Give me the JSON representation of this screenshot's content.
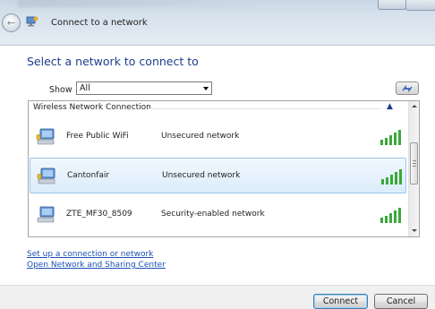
{
  "window": {
    "title": "Connect to a network"
  },
  "heading": "Select a network to connect to",
  "filter": {
    "label": "Show",
    "selected": "All"
  },
  "network_list": {
    "group_label": "Wireless Network Connection",
    "networks": [
      {
        "ssid": "Free Public WiFi",
        "security": "Unsecured network",
        "selected": false,
        "signal_bars": 5,
        "shield": true
      },
      {
        "ssid": "Cantonfair",
        "security": "Unsecured network",
        "selected": true,
        "signal_bars": 5,
        "shield": true
      },
      {
        "ssid": "ZTE_MF30_8509",
        "security": "Security-enabled network",
        "selected": false,
        "signal_bars": 5,
        "shield": false
      }
    ]
  },
  "links": {
    "setup": "Set up a connection or network",
    "sharing_center": "Open Network and Sharing Center"
  },
  "buttons": {
    "connect": "Connect",
    "cancel": "Cancel"
  },
  "colors": {
    "heading": "#1e3e8c",
    "link": "#1e50b4",
    "signal": "#3aa83a",
    "selection": "#dcecfb"
  },
  "icons": {
    "back": "back-arrow-icon",
    "wizard": "network-wizard-icon",
    "refresh": "refresh-icon",
    "computer": "network-computer-icon",
    "signal": "signal-strength-icon",
    "shield": "security-shield-icon"
  }
}
